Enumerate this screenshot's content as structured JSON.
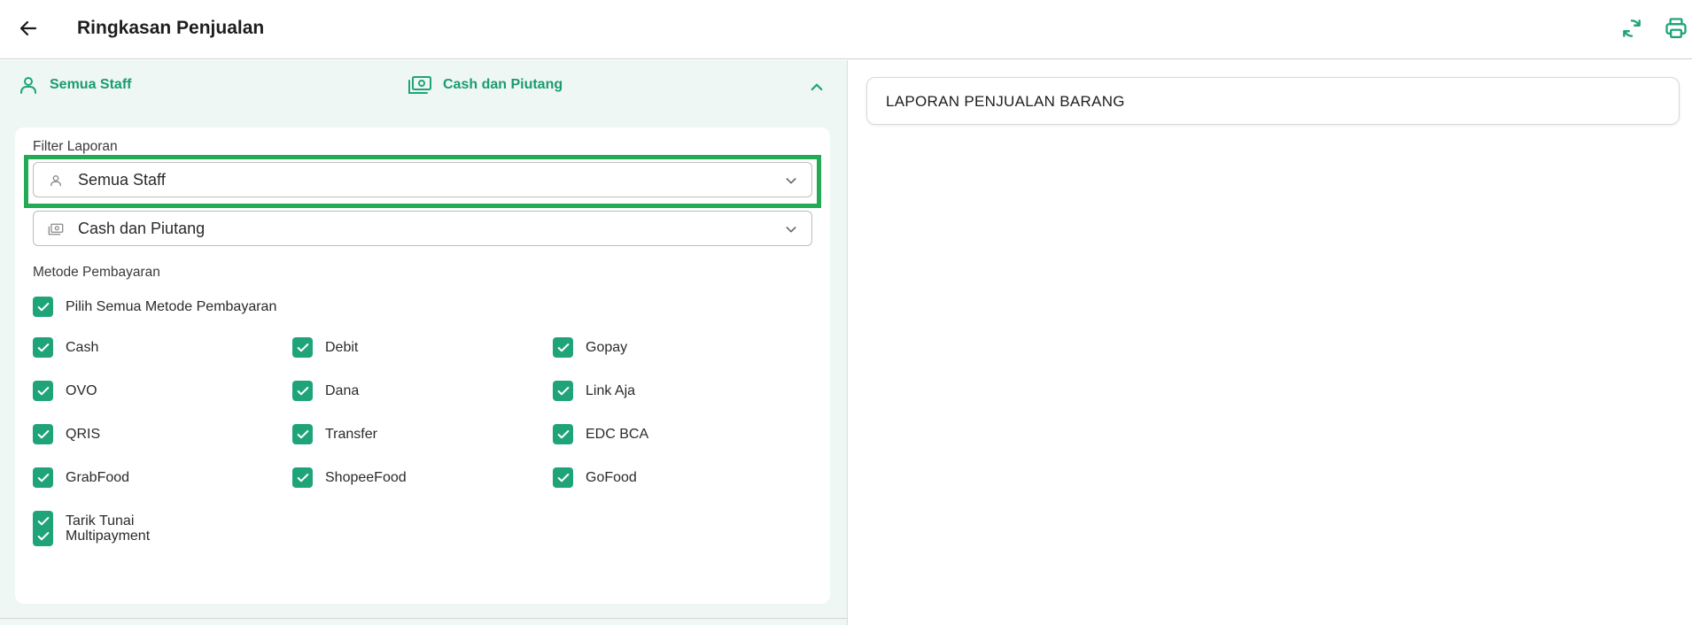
{
  "header": {
    "title": "Ringkasan Penjualan",
    "back_icon": "arrow-left-icon",
    "refresh_icon": "refresh-icon",
    "print_icon": "printer-icon"
  },
  "summary": {
    "staff_label": "Semua Staff",
    "payment_label": "Cash dan Piutang",
    "collapse_icon": "chevron-up-icon"
  },
  "filter": {
    "section_title": "Filter Laporan",
    "staff_value": "Semua Staff",
    "payment_type_value": "Cash dan Piutang"
  },
  "payment_methods": {
    "section_title": "Metode Pembayaran",
    "select_all_label": "Pilih Semua Metode Pembayaran",
    "select_all_checked": true,
    "items": [
      {
        "label": "Cash",
        "checked": true
      },
      {
        "label": "Debit",
        "checked": true
      },
      {
        "label": "Gopay",
        "checked": true
      },
      {
        "label": "OVO",
        "checked": true
      },
      {
        "label": "Dana",
        "checked": true
      },
      {
        "label": "Link Aja",
        "checked": true
      },
      {
        "label": "QRIS",
        "checked": true
      },
      {
        "label": "Transfer",
        "checked": true
      },
      {
        "label": "EDC BCA",
        "checked": true
      },
      {
        "label": "GrabFood",
        "checked": true
      },
      {
        "label": "ShopeeFood",
        "checked": true
      },
      {
        "label": "GoFood",
        "checked": true
      },
      {
        "label": "Tarik Tunai",
        "checked": true
      }
    ],
    "multipayment_label": "Multipayment",
    "multipayment_checked": true
  },
  "report": {
    "title": "LAPORAN PENJUALAN BARANG"
  },
  "colors": {
    "accent": "#1fa47a",
    "accent_text": "#1a9b72",
    "panel_bg": "#eef7f3",
    "highlight": "#22aa55"
  }
}
